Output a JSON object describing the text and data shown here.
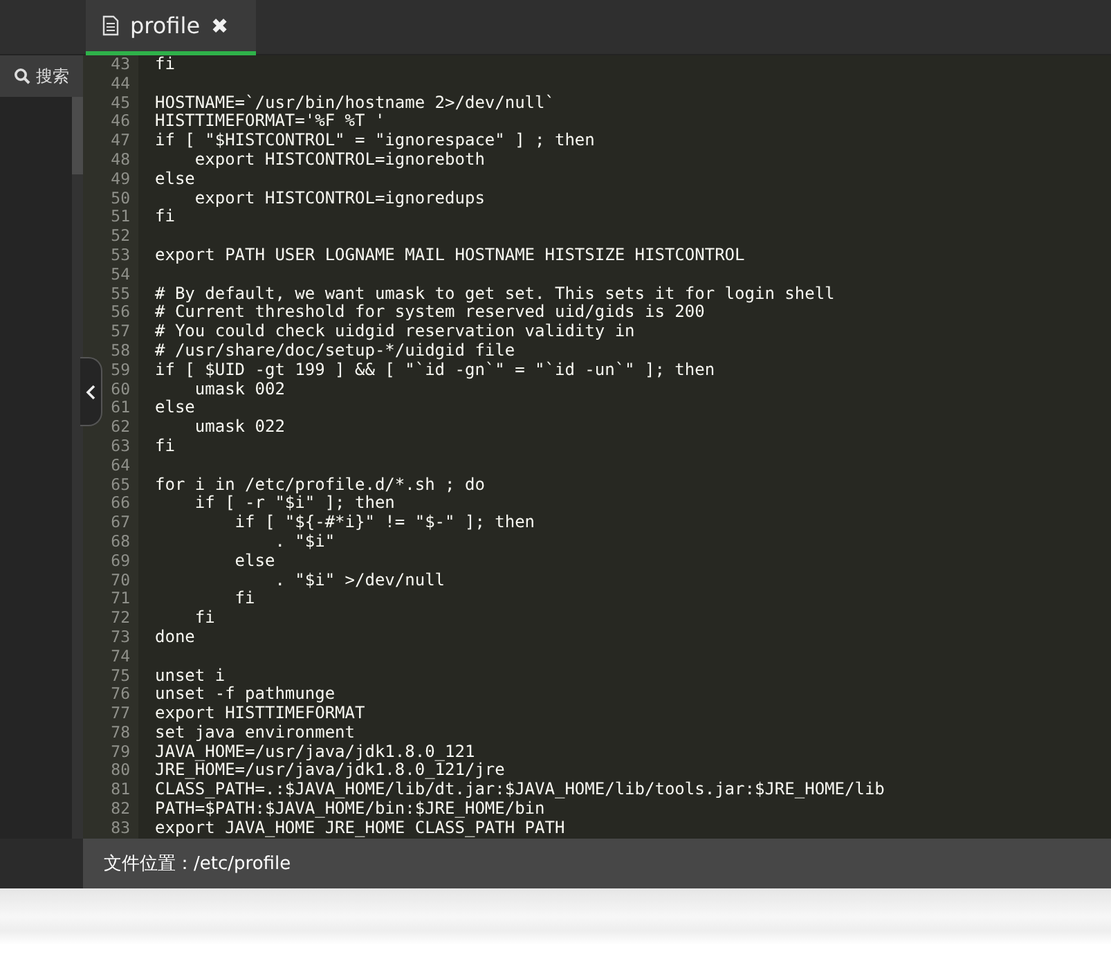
{
  "tabs": [
    {
      "label": "profile",
      "selected": true,
      "close": "✖"
    }
  ],
  "sidebar": {
    "search_button": "搜索"
  },
  "editor": {
    "lines": [
      {
        "number": "43",
        "text": "fi"
      },
      {
        "number": "44"
      },
      {
        "number": "45",
        "text": "HOSTNAME=`/usr/bin/hostname 2>/dev/null`"
      },
      {
        "number": "46",
        "text": "HISTTIMEFORMAT='%F %T '"
      },
      {
        "number": "47",
        "text": "if [ \"$HISTCONTROL\" = \"ignorespace\" ] ; then"
      },
      {
        "number": "48",
        "text": "    export HISTCONTROL=ignoreboth"
      },
      {
        "number": "49",
        "text": "else"
      },
      {
        "number": "50",
        "text": "    export HISTCONTROL=ignoredups"
      },
      {
        "number": "51",
        "text": "fi"
      },
      {
        "number": "52"
      },
      {
        "number": "53",
        "text": "export PATH USER LOGNAME MAIL HOSTNAME HISTSIZE HISTCONTROL"
      },
      {
        "number": "54"
      },
      {
        "number": "55",
        "text": "# By default, we want umask to get set. This sets it for login shell"
      },
      {
        "number": "56",
        "text": "# Current threshold for system reserved uid/gids is 200"
      },
      {
        "number": "57",
        "text": "# You could check uidgid reservation validity in"
      },
      {
        "number": "58",
        "text": "# /usr/share/doc/setup-*/uidgid file"
      },
      {
        "number": "59",
        "text": "if [ $UID -gt 199 ] && [ \"`id -gn`\" = \"`id -un`\" ]; then"
      },
      {
        "number": "60",
        "text": "    umask 002"
      },
      {
        "number": "61",
        "text": "else"
      },
      {
        "number": "62",
        "text": "    umask 022"
      },
      {
        "number": "63",
        "text": "fi"
      },
      {
        "number": "64"
      },
      {
        "number": "65",
        "text": "for i in /etc/profile.d/*.sh ; do"
      },
      {
        "number": "66",
        "text": "    if [ -r \"$i\" ]; then"
      },
      {
        "number": "67",
        "text": "        if [ \"${-#*i}\" != \"$-\" ]; then"
      },
      {
        "number": "68",
        "text": "            . \"$i\""
      },
      {
        "number": "69",
        "text": "        else"
      },
      {
        "number": "70",
        "text": "            . \"$i\" >/dev/null"
      },
      {
        "number": "71",
        "text": "        fi"
      },
      {
        "number": "72",
        "text": "    fi"
      },
      {
        "number": "73",
        "text": "done"
      },
      {
        "number": "74"
      },
      {
        "number": "75",
        "text": "unset i"
      },
      {
        "number": "76",
        "text": "unset -f pathmunge"
      },
      {
        "number": "77",
        "text": "export HISTTIMEFORMAT"
      },
      {
        "number": "78",
        "text": "set java environment"
      },
      {
        "number": "79",
        "text": "JAVA_HOME=/usr/java/jdk1.8.0_121"
      },
      {
        "number": "80",
        "text": "JRE_HOME=/usr/java/jdk1.8.0_121/jre"
      },
      {
        "number": "81",
        "text": "CLASS_PATH=.:$JAVA_HOME/lib/dt.jar:$JAVA_HOME/lib/tools.jar:$JRE_HOME/lib"
      },
      {
        "number": "82",
        "text": "PATH=$PATH:$JAVA_HOME/bin:$JRE_HOME/bin"
      },
      {
        "number": "83",
        "text": "export JAVA_HOME JRE_HOME CLASS_PATH PATH"
      }
    ]
  },
  "status_bar": {
    "file_location": "文件位置：/etc/profile"
  }
}
